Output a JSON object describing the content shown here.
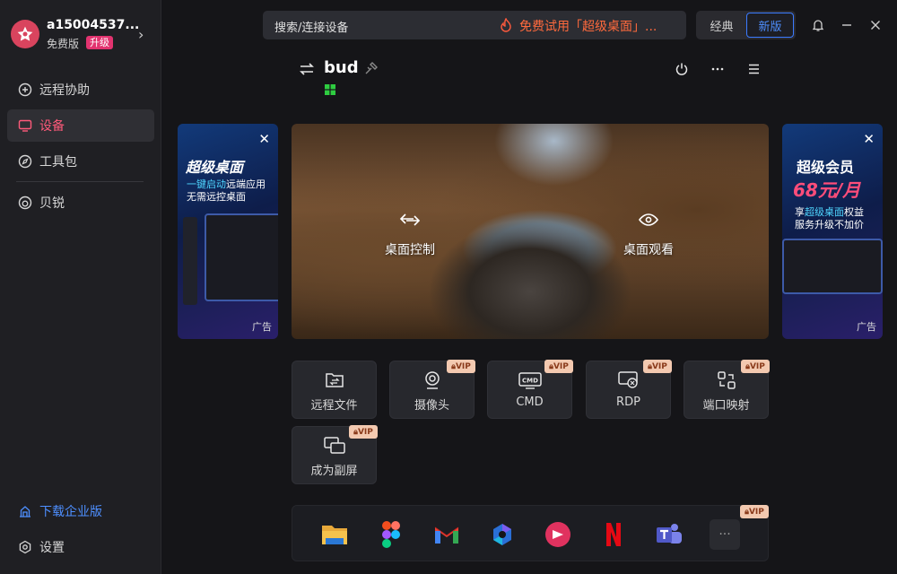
{
  "user": {
    "name": "a15004537...",
    "plan": "免费版",
    "upgrade": "升级"
  },
  "nav": {
    "items": [
      {
        "label": "远程协助",
        "icon": "remote-assist-icon"
      },
      {
        "label": "设备",
        "icon": "device-icon"
      },
      {
        "label": "工具包",
        "icon": "compass-icon"
      },
      {
        "label": "贝锐",
        "icon": "oray-icon"
      }
    ],
    "enterprise": "下载企业版",
    "settings": "设置"
  },
  "topbar": {
    "search_placeholder": "搜索/连接设备",
    "promo": "免费试用「超级桌面」...",
    "mode_classic": "经典",
    "mode_new": "新版"
  },
  "device": {
    "name": "bud",
    "os_icon": "windows-icon"
  },
  "banner_left": {
    "title": "超级桌面",
    "line1a": "一键启动",
    "line1b": "远端应用",
    "line2": "无需远控桌面",
    "ad": "广告"
  },
  "banner_right": {
    "title": "超级会员",
    "price": "68元/月",
    "line1a": "享",
    "line1b": "超级桌面",
    "line1c": "权益",
    "line2": "服务升级不加价",
    "ad": "广告"
  },
  "preview": {
    "control": "桌面控制",
    "watch": "桌面观看"
  },
  "tiles": [
    {
      "label": "远程文件",
      "vip": false
    },
    {
      "label": "摄像头",
      "vip": true
    },
    {
      "label": "CMD",
      "vip": true
    },
    {
      "label": "RDP",
      "vip": true
    },
    {
      "label": "端口映射",
      "vip": true
    },
    {
      "label": "成为副屏",
      "vip": true
    }
  ],
  "vip_badge": "VIP",
  "more_dots": "···",
  "colors": {
    "accent": "#ff5a7a",
    "link": "#4e8fff",
    "promo": "#ff6a3d",
    "upgrade": "#e2336f"
  }
}
